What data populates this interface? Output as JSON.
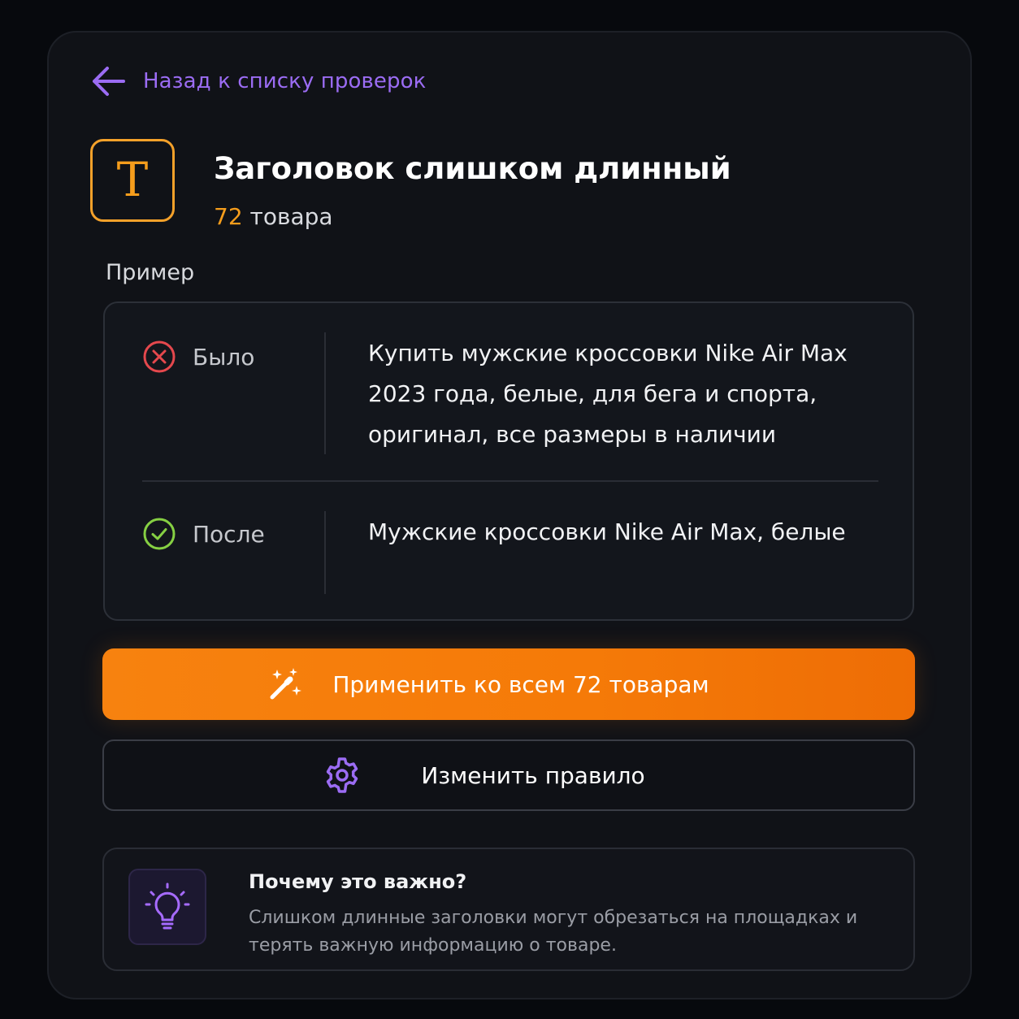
{
  "nav": {
    "back_label": "Назад к списку проверок"
  },
  "header": {
    "icon_letter": "T",
    "title": "Заголовок слишком длинный",
    "count_value": "72",
    "count_suffix": "товара"
  },
  "example": {
    "section_label": "Пример",
    "before": {
      "label": "Было",
      "text": "Купить мужские кроссовки Nike Air Max 2023 года, белые, для бега и спорта, оригинал, все размеры в наличии"
    },
    "after": {
      "label": "После",
      "text": "Мужские кроссовки Nike Air Max, белые"
    }
  },
  "actions": {
    "apply_label": "Применить ко всем 72 товарам",
    "edit_label": "Изменить правило"
  },
  "info": {
    "title": "Почему это важно?",
    "body": "Слишком длинные заголовки могут обрезаться на площадках и терять важную информацию о товаре."
  },
  "icons": {
    "back": "arrow-left-icon",
    "title": "text-t-icon",
    "before": "x-circle-icon",
    "after": "check-circle-icon",
    "apply": "magic-wand-icon",
    "edit": "gear-icon",
    "info": "lightbulb-icon"
  },
  "colors": {
    "accent_purple": "#9b6cf3",
    "accent_orange": "#f59d1c",
    "button_orange": "#f57a08",
    "error_red": "#e5484d",
    "success_green": "#86d043",
    "background": "#07090d",
    "panel": "#101217"
  }
}
